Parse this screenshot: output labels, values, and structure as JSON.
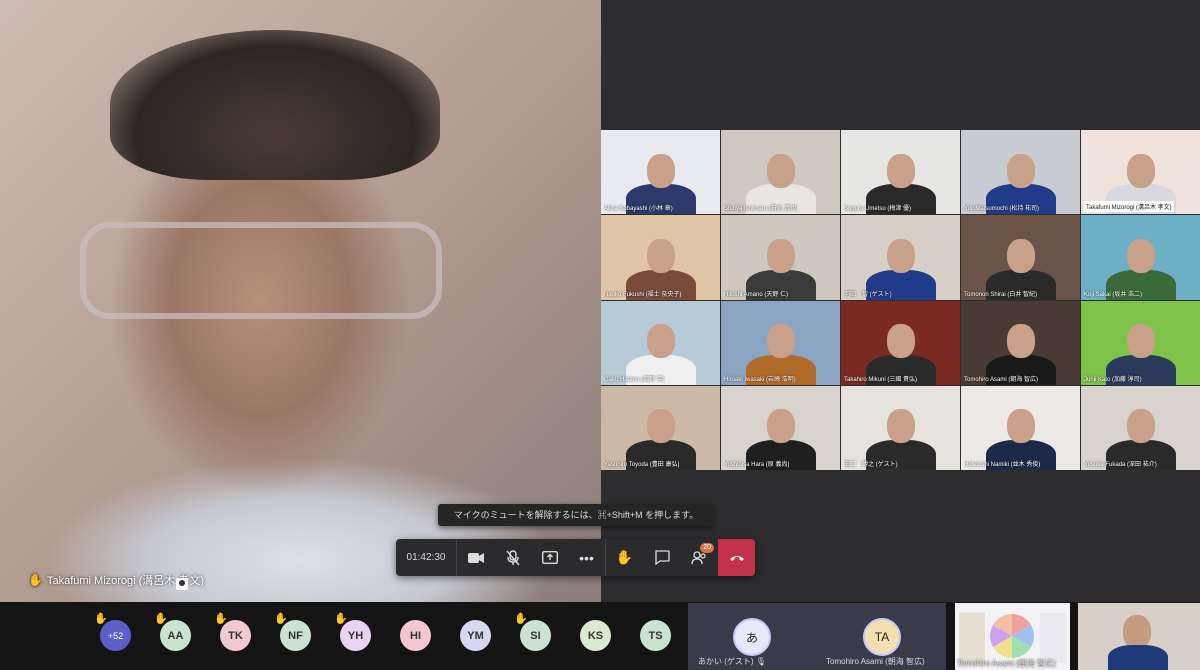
{
  "main_video": {
    "name": "Takafumi Mizorogi (溝呂木 孝文)"
  },
  "grid": [
    {
      "label": "Akira Kobayashi (小林 章)",
      "bg": "#e8eaf0",
      "shirt": "#2b3a6b"
    },
    {
      "label": "Shinya Ishimaru (石丸 真也)",
      "bg": "#cfc9c2",
      "shirt": "#e9e6e2"
    },
    {
      "label": "Suguru Umetsu (梅津 優)",
      "bg": "#e6e6e4",
      "shirt": "#2a2a2a"
    },
    {
      "label": "Yuji Matsumochi (松持 祐司)",
      "bg": "#c9cbd3",
      "shirt": "#1f3b8a"
    },
    {
      "label": "Takafumi Mizorogi (溝呂木 孝文)",
      "bg": "#efe3dc",
      "shirt": "#d8d8e0",
      "boxed": true
    },
    {
      "label": "Naoko Fukushi (福士 奈央子)",
      "bg": "#e0c6a6",
      "shirt": "#7a4a3a"
    },
    {
      "label": "Hitoshi Amano (天野 仁)",
      "bg": "#cfc8bf",
      "shirt": "#3b3b3b"
    },
    {
      "label": "羽田　智 (ゲスト)",
      "bg": "#d8d0c6",
      "shirt": "#213a8a"
    },
    {
      "label": "Tomonori Shirai (白井 智紀)",
      "bg": "#6b5348",
      "shirt": "#2a2a2a"
    },
    {
      "label": "Koji Sakai (坂井 浩二)",
      "bg": "#6db0c6",
      "shirt": "#3a6a3a"
    },
    {
      "label": "Gaku Hatano (畑野 学)",
      "bg": "#b7cbd6",
      "shirt": "#f0f0f0"
    },
    {
      "label": "Hiroaki Iwasaki (岩崎 浩明)",
      "bg": "#8aa4c2",
      "shirt": "#b06a2a"
    },
    {
      "label": "Takahiro Mikuni (三國 貴弘)",
      "bg": "#7a2a20",
      "shirt": "#2a2a2a"
    },
    {
      "label": "Tomohiro Asami (朝海 智広)",
      "bg": "#4a3a34",
      "shirt": "#1a1a1a"
    },
    {
      "label": "Junji Kato (加藤 淳司)",
      "bg": "#7fc24a",
      "shirt": "#2a3a5a"
    },
    {
      "label": "Yasuhiro Toyoda (豊田 康弘)",
      "bg": "#cbb9a6",
      "shirt": "#2a2a2a"
    },
    {
      "label": "Yoshihisa Hara (原 義尚)",
      "bg": "#d8d3cc",
      "shirt": "#1e1e1e"
    },
    {
      "label": "田口　博之 (ゲスト)",
      "bg": "#e6e2dc",
      "shirt": "#2a2a2a"
    },
    {
      "label": "Hidetoshi Namiki (並木 秀俊)",
      "bg": "#ece9e6",
      "shirt": "#1c2a4a"
    },
    {
      "label": "Yusuke Fukada (深田 祐介)",
      "bg": "#d8d3cf",
      "shirt": "#2a2a2a"
    }
  ],
  "tooltip": "マイクのミュートを解除するには、⌘+Shift+M を押します。",
  "toolbar": {
    "timer": "01:42:30",
    "participants_badge": "20",
    "camera_icon": "camera-icon",
    "mic_icon": "mic-off-icon",
    "share_icon": "share-screen-icon",
    "more_icon": "more-icon",
    "hand_icon": "raise-hand-icon",
    "chat_icon": "chat-icon",
    "people_icon": "people-icon",
    "hangup_icon": "hangup-icon"
  },
  "strip": {
    "more_count": "+52",
    "avatars": [
      {
        "initials": "AA",
        "color": "#c9e3cf",
        "hand": true
      },
      {
        "initials": "TK",
        "color": "#f2c9d0",
        "hand": true
      },
      {
        "initials": "NF",
        "color": "#c9e3cf",
        "hand": true
      },
      {
        "initials": "YH",
        "color": "#e8d4f0",
        "hand": true
      },
      {
        "initials": "HI",
        "color": "#f2c9d0",
        "hand": false
      },
      {
        "initials": "YM",
        "color": "#d6d8f2",
        "hand": false
      },
      {
        "initials": "SI",
        "color": "#c9e3cf",
        "hand": true
      },
      {
        "initials": "KS",
        "color": "#d8ebd0",
        "hand": false
      },
      {
        "initials": "TS",
        "color": "#c9e3cf",
        "hand": false
      }
    ],
    "guest1": {
      "initial": "あ",
      "name": "あかい (ゲスト)"
    },
    "guest2": {
      "initial": "TA",
      "name": "Tomohiro Asami (朝海 智広)"
    },
    "share_name": "Tomohiro Asami (朝海 智広)"
  }
}
